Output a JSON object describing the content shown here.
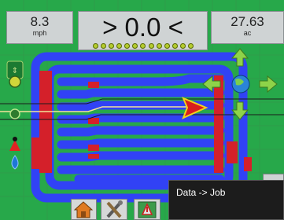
{
  "speed": {
    "value": "8.3",
    "unit": "mph"
  },
  "cross_track": {
    "value": "> 0.0 <",
    "leds": 13
  },
  "area": {
    "value": "27.63",
    "unit": "ac"
  },
  "left_icons": [
    "auto-steer-icon",
    "record-icon",
    "boundary-icon",
    "marker-icon",
    "water-drop-icon"
  ],
  "nav_icons": [
    "pan-up-icon",
    "pan-left-icon",
    "globe-icon",
    "pan-right-icon",
    "pan-down-icon"
  ],
  "toolbar": [
    "home-icon",
    "tools-icon",
    "field-map-icon"
  ],
  "tooltip": {
    "text": "Data -> Job"
  },
  "colors": {
    "field": "#27a84a",
    "coverage": "#3142f5",
    "overlap": "#d4202a",
    "panel": "#cfd3d4",
    "guidance_line": "#f2e39a"
  }
}
